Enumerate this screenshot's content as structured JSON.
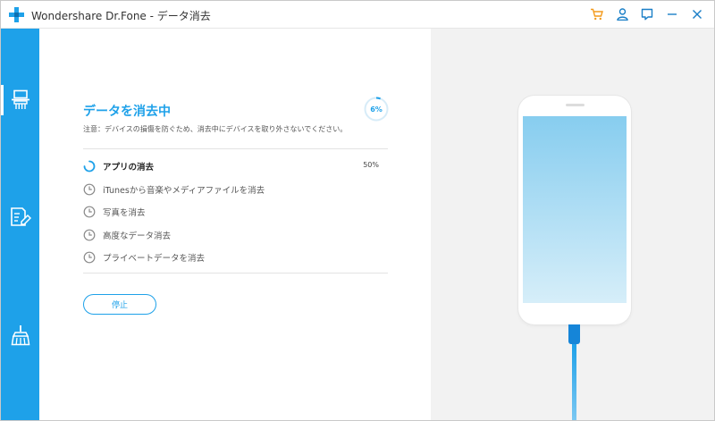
{
  "window": {
    "title": "Wondershare Dr.Fone - データ消去"
  },
  "colors": {
    "accent": "#1ea1e9",
    "sidebar": "#1ea1e9",
    "right_panel": "#f2f2f2",
    "cart_icon": "#f39a1b"
  },
  "titlebar_icons": [
    "cart-icon",
    "user-icon",
    "feedback-icon",
    "minimize-icon",
    "close-icon"
  ],
  "sidebar": {
    "items": [
      {
        "icon": "erase-device-icon",
        "active": true
      },
      {
        "icon": "erase-private-data-icon",
        "active": false
      },
      {
        "icon": "cleanup-broom-icon",
        "active": false
      }
    ]
  },
  "main": {
    "heading": "データを消去中",
    "progress": {
      "value": 6,
      "text": "6%"
    },
    "note": "注意：デバイスの損傷を防ぐため、消去中にデバイスを取り外さないでください。",
    "tasks": [
      {
        "label": "アプリの消去",
        "status": "in-progress",
        "percent": "50%"
      },
      {
        "label": "iTunesから音楽やメディアファイルを消去",
        "status": "pending",
        "percent": ""
      },
      {
        "label": "写真を消去",
        "status": "pending",
        "percent": ""
      },
      {
        "label": "高度なデータ消去",
        "status": "pending",
        "percent": ""
      },
      {
        "label": "プライベートデータを消去",
        "status": "pending",
        "percent": ""
      }
    ],
    "stop_button": "停止"
  }
}
